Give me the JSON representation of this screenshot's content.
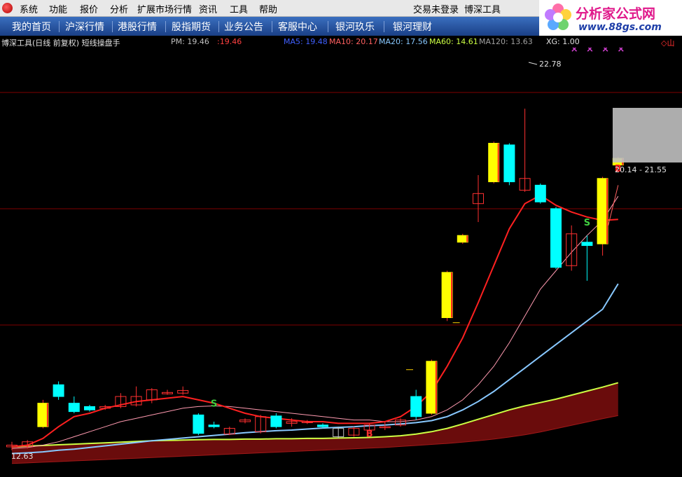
{
  "menubar": {
    "items": [
      "系统",
      "功能",
      "报价",
      "分析",
      "扩展市场行情",
      "资讯",
      "工具",
      "帮助"
    ],
    "login_status": "交易未登录",
    "app_name": "博深工具"
  },
  "tabs": [
    "我的首页",
    "沪深行情",
    "港股行情",
    "股指期货",
    "业务公告",
    "客服中心",
    "银河玖乐",
    "银河理财"
  ],
  "watermark": {
    "title": "分析家公式网",
    "url": "www.88gs.com"
  },
  "infobar": {
    "title": "博深工具(日线 前复权) 短线操盘手",
    "pm_label": "PM: 19.46",
    "pm_extra": ":19.46",
    "ma5": "MA5: 19.48",
    "ma10": "MA10: 20.17",
    "ma20": "MA20: 17.56",
    "ma60": "MA60: 14.61",
    "ma120": "MA120: 13.63",
    "xg": "XG: 1.00",
    "right_icon": "◇山"
  },
  "colors": {
    "up": "#ffff00",
    "down": "#00ffff",
    "hollow_up": "#ff3030",
    "ma5": "#ff2020",
    "ma10": "#ff9ab0",
    "ma20": "#88c8ff",
    "ma60": "#ccff44",
    "ma120": "#b02020",
    "grid": "#800000"
  },
  "chart_data": {
    "type": "candlestick",
    "title": "",
    "ylim": [
      11.8,
      24.6
    ],
    "annotations": {
      "high_label": "22.78",
      "low_label": "12.63",
      "range_label": "20.14 - 21.55",
      "buy_marker": "B",
      "sell_marker": "S"
    },
    "candles": [
      {
        "o": 12.75,
        "h": 12.85,
        "l": 12.6,
        "c": 12.7,
        "s": "hr"
      },
      {
        "o": 12.72,
        "h": 12.9,
        "l": 12.65,
        "c": 12.85,
        "s": "hr"
      },
      {
        "o": 13.3,
        "h": 14.1,
        "l": 13.25,
        "c": 14.0,
        "s": "y"
      },
      {
        "o": 14.2,
        "h": 14.65,
        "l": 14.1,
        "c": 14.55,
        "s": "c"
      },
      {
        "o": 14.0,
        "h": 14.2,
        "l": 13.7,
        "c": 13.75,
        "s": "c"
      },
      {
        "o": 13.9,
        "h": 13.95,
        "l": 13.75,
        "c": 13.8,
        "s": "c"
      },
      {
        "o": 13.85,
        "h": 13.95,
        "l": 13.8,
        "c": 13.9,
        "s": "hr"
      },
      {
        "o": 13.9,
        "h": 14.3,
        "l": 13.85,
        "c": 14.2,
        "s": "hr"
      },
      {
        "o": 13.95,
        "h": 14.5,
        "l": 13.9,
        "c": 14.2,
        "s": "hr"
      },
      {
        "o": 14.1,
        "h": 14.45,
        "l": 14.0,
        "c": 14.4,
        "s": "hr"
      },
      {
        "o": 14.28,
        "h": 14.4,
        "l": 14.25,
        "c": 14.32,
        "s": "hr"
      },
      {
        "o": 14.3,
        "h": 14.5,
        "l": 14.25,
        "c": 14.38,
        "s": "hr"
      },
      {
        "o": 13.65,
        "h": 13.7,
        "l": 13.05,
        "c": 13.1,
        "s": "c"
      },
      {
        "o": 13.35,
        "h": 13.45,
        "l": 13.25,
        "c": 13.3,
        "s": "c"
      },
      {
        "o": 13.08,
        "h": 13.3,
        "l": 13.05,
        "c": 13.25,
        "s": "hr"
      },
      {
        "o": 13.45,
        "h": 13.55,
        "l": 13.4,
        "c": 13.5,
        "s": "hr"
      },
      {
        "o": 13.15,
        "h": 13.65,
        "l": 13.1,
        "c": 13.6,
        "s": "hr"
      },
      {
        "o": 13.62,
        "h": 13.7,
        "l": 13.25,
        "c": 13.3,
        "s": "c"
      },
      {
        "o": 13.4,
        "h": 13.55,
        "l": 13.3,
        "c": 13.45,
        "s": "hr"
      },
      {
        "o": 13.42,
        "h": 13.5,
        "l": 13.38,
        "c": 13.45,
        "s": "hr"
      },
      {
        "o": 13.35,
        "h": 13.4,
        "l": 13.25,
        "c": 13.3,
        "s": "c"
      },
      {
        "o": 13.0,
        "h": 13.3,
        "l": 12.95,
        "c": 13.25,
        "s": "hg"
      },
      {
        "o": 13.05,
        "h": 13.3,
        "l": 13.0,
        "c": 13.25,
        "s": "hr"
      },
      {
        "o": 13.2,
        "h": 13.4,
        "l": 13.15,
        "c": 13.35,
        "s": "hr"
      },
      {
        "o": 13.28,
        "h": 13.45,
        "l": 13.2,
        "c": 13.3,
        "s": "hr"
      },
      {
        "o": 13.35,
        "h": 13.55,
        "l": 13.3,
        "c": 13.5,
        "s": "hr"
      },
      {
        "o": 14.2,
        "h": 14.4,
        "l": 13.5,
        "c": 13.6,
        "s": "c"
      },
      {
        "o": 13.7,
        "h": 15.3,
        "l": 13.65,
        "c": 15.25,
        "s": "y"
      },
      {
        "o": 16.55,
        "h": 17.95,
        "l": 16.45,
        "c": 17.9,
        "s": "y"
      },
      {
        "o": 18.8,
        "h": 19.05,
        "l": 18.75,
        "c": 19.0,
        "s": "y"
      },
      {
        "o": 19.95,
        "h": 20.8,
        "l": 19.4,
        "c": 20.25,
        "s": "hr"
      },
      {
        "o": 20.6,
        "h": 21.8,
        "l": 20.55,
        "c": 21.75,
        "s": "y"
      },
      {
        "o": 21.7,
        "h": 21.75,
        "l": 20.5,
        "c": 20.6,
        "s": "c"
      },
      {
        "o": 20.35,
        "h": 22.78,
        "l": 20.3,
        "c": 20.7,
        "s": "hr"
      },
      {
        "o": 20.5,
        "h": 20.55,
        "l": 19.95,
        "c": 20.0,
        "s": "c"
      },
      {
        "o": 19.8,
        "h": 19.85,
        "l": 18.0,
        "c": 18.05,
        "s": "c"
      },
      {
        "o": 18.1,
        "h": 19.3,
        "l": 17.95,
        "c": 19.05,
        "s": "hr"
      },
      {
        "o": 18.8,
        "h": 19.0,
        "l": 17.65,
        "c": 18.7,
        "s": "c"
      },
      {
        "o": 18.75,
        "h": 20.75,
        "l": 18.4,
        "c": 20.7,
        "s": "y"
      },
      {
        "o": 21.1,
        "h": 21.35,
        "l": 21.0,
        "c": 21.3,
        "s": "y"
      }
    ],
    "ma5": [
      12.7,
      12.75,
      12.95,
      13.3,
      13.6,
      13.7,
      13.85,
      13.95,
      14.05,
      14.1,
      14.15,
      14.2,
      14.1,
      14.0,
      13.85,
      13.7,
      13.6,
      13.55,
      13.5,
      13.45,
      13.45,
      13.4,
      13.4,
      13.4,
      13.45,
      13.6,
      13.9,
      14.35,
      15.1,
      15.95,
      17.0,
      18.1,
      19.2,
      19.95,
      20.2,
      19.9,
      19.7,
      19.55,
      19.45,
      19.48
    ],
    "ma10": [
      12.65,
      12.68,
      12.75,
      12.85,
      13.0,
      13.15,
      13.3,
      13.45,
      13.55,
      13.65,
      13.75,
      13.85,
      13.9,
      13.92,
      13.9,
      13.85,
      13.8,
      13.75,
      13.7,
      13.65,
      13.6,
      13.55,
      13.5,
      13.5,
      13.45,
      13.45,
      13.5,
      13.6,
      13.8,
      14.1,
      14.55,
      15.1,
      15.8,
      16.6,
      17.4,
      17.95,
      18.5,
      19.0,
      19.45,
      20.17
    ],
    "ma20": [
      12.5,
      12.52,
      12.55,
      12.6,
      12.63,
      12.68,
      12.73,
      12.78,
      12.83,
      12.88,
      12.92,
      12.96,
      13.0,
      13.04,
      13.08,
      13.12,
      13.15,
      13.18,
      13.2,
      13.23,
      13.26,
      13.28,
      13.3,
      13.33,
      13.35,
      13.38,
      13.42,
      13.48,
      13.6,
      13.8,
      14.05,
      14.35,
      14.7,
      15.05,
      15.4,
      15.75,
      16.1,
      16.45,
      16.8,
      17.56
    ],
    "ma60": [
      12.7,
      12.72,
      12.74,
      12.76,
      12.78,
      12.8,
      12.82,
      12.84,
      12.86,
      12.88,
      12.89,
      12.9,
      12.91,
      12.92,
      12.92,
      12.93,
      12.93,
      12.94,
      12.94,
      12.95,
      12.95,
      12.96,
      12.97,
      12.98,
      13.0,
      13.03,
      13.08,
      13.15,
      13.25,
      13.38,
      13.52,
      13.66,
      13.8,
      13.92,
      14.02,
      14.12,
      14.24,
      14.36,
      14.48,
      14.61
    ],
    "ma120": [
      12.2,
      12.22,
      12.24,
      12.26,
      12.28,
      12.3,
      12.32,
      12.34,
      12.36,
      12.38,
      12.4,
      12.42,
      12.44,
      12.46,
      12.48,
      12.5,
      12.52,
      12.54,
      12.56,
      12.58,
      12.6,
      12.62,
      12.64,
      12.66,
      12.68,
      12.71,
      12.74,
      12.77,
      12.8,
      12.84,
      12.88,
      12.93,
      12.99,
      13.06,
      13.14,
      13.24,
      13.34,
      13.44,
      13.54,
      13.63
    ]
  }
}
